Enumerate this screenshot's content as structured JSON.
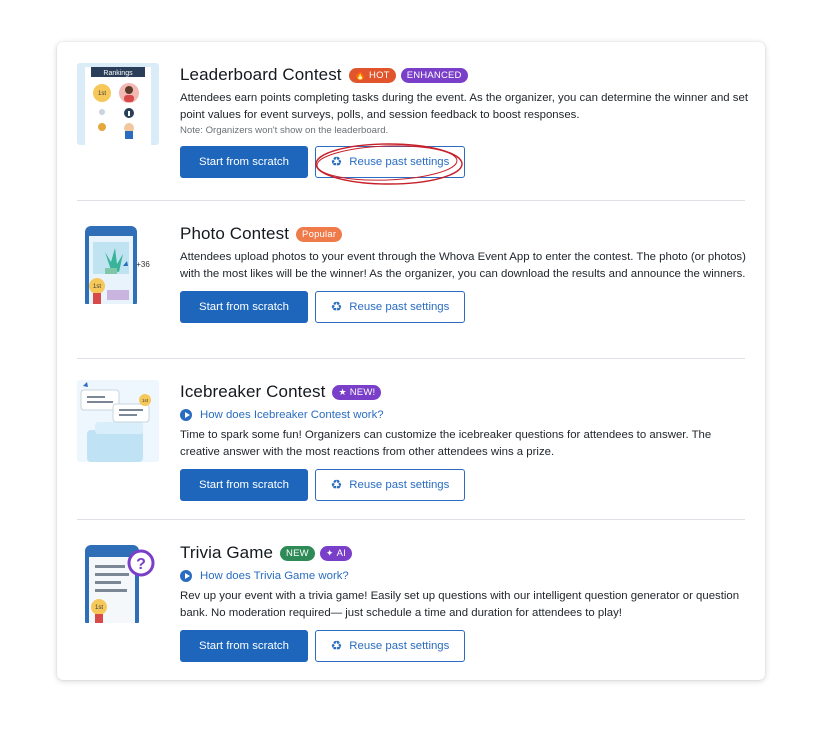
{
  "contests": [
    {
      "title": "Leaderboard Contest",
      "badges": [
        {
          "icon": "fire-icon",
          "glyph": "🔥",
          "label": "HOT",
          "color": "#e0552b"
        },
        {
          "label": "ENHANCED",
          "color": "#7a3fc8"
        }
      ],
      "thumbnail": {
        "icon": "rankings-illustration",
        "caption": "Rankings",
        "rank_label": "1st"
      },
      "description": "Attendees earn points completing tasks during the event. As the organizer, you can determine the winner and set point values for event surveys, polls, and session feedback to boost responses.",
      "note": "Note: Organizers won't show on the leaderboard.",
      "start_label": "Start from scratch",
      "reuse_label": "Reuse past settings",
      "reuse_icon": "recycle-icon"
    },
    {
      "title": "Photo Contest",
      "badges": [
        {
          "label": "Popular",
          "color": "#ef7b4b"
        }
      ],
      "thumbnail": {
        "icon": "photo-contest-illustration",
        "likes": "+36",
        "rank_label": "1st"
      },
      "description": "Attendees upload photos to your event through the Whova Event App to enter the contest. The photo (or photos) with the most likes will be the winner! As the organizer, you can download the results and announce the winners.",
      "start_label": "Start from scratch",
      "reuse_label": "Reuse past settings",
      "reuse_icon": "recycle-icon"
    },
    {
      "title": "Icebreaker Contest",
      "badges": [
        {
          "icon": "star-icon",
          "glyph": "★",
          "label": "NEW!",
          "color": "#7a3fc8"
        }
      ],
      "thumbnail": {
        "icon": "icebreaker-illustration",
        "rank_label": "1st"
      },
      "how_link": "How does Icebreaker Contest work?",
      "description": "Time to spark some fun! Organizers can customize the icebreaker questions for attendees to answer. The creative answer with the most reactions from other attendees wins a prize.",
      "start_label": "Start from scratch",
      "reuse_label": "Reuse past settings",
      "reuse_icon": "recycle-icon"
    },
    {
      "title": "Trivia Game",
      "badges": [
        {
          "label": "NEW",
          "color": "#2e8b57"
        },
        {
          "icon": "sparkle-icon",
          "glyph": "✦",
          "label": "AI",
          "color": "#7a3fc8"
        }
      ],
      "thumbnail": {
        "icon": "trivia-illustration",
        "rank_label": "1st"
      },
      "how_link": "How does Trivia Game work?",
      "description": "Rev up your event with a trivia game!  Easily set up questions with our intelligent question generator or question bank. No moderation required— just schedule a time and duration for attendees to play!",
      "start_label": "Start from scratch",
      "reuse_label": "Reuse past settings",
      "reuse_icon": "recycle-icon"
    }
  ],
  "colors": {
    "primary": "#1d66bb",
    "link": "#2a6dc0",
    "annotation": "#c8202a"
  }
}
